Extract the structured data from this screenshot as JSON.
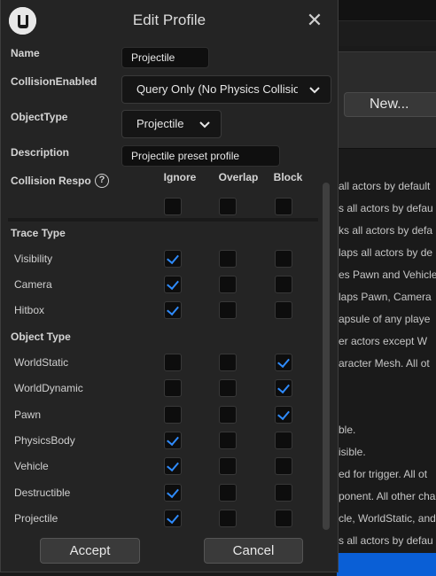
{
  "background": {
    "new_button": "New...",
    "description_lines": [
      "all actors by default",
      "s all actors by defau",
      "ks all actors by defa",
      "laps all actors by de",
      "es Pawn and Vehicle",
      "laps Pawn, Camera",
      "apsule of any playe",
      "er actors except W",
      "aracter Mesh. All ot",
      "ble.",
      "isible.",
      "ed for trigger. All ot",
      "ponent. All other cha",
      "cle, WorldStatic, and",
      "s all actors by defau"
    ],
    "accent_color": "#0a5fd6"
  },
  "dialog": {
    "title": "Edit Profile",
    "logo_icon": "unreal-logo-icon",
    "close_icon": "close-icon",
    "close_glyph": "✕",
    "fields": {
      "name_label": "Name",
      "name_value": "Projectile",
      "collision_label": "CollisionEnabled",
      "collision_value": "Query Only (No Physics Collision)",
      "object_type_label": "ObjectType",
      "object_type_value": "Projectile",
      "description_label": "Description",
      "description_value": "Projectile preset profile"
    },
    "responses_header": {
      "label": "Collision Respo",
      "help_glyph": "?",
      "columns": [
        "Ignore",
        "Overlap",
        "Block"
      ]
    },
    "all_row": [
      false,
      false,
      false
    ],
    "trace_type_label": "Trace Type",
    "trace_rows": [
      {
        "label": "Visibility",
        "checks": [
          true,
          false,
          false
        ]
      },
      {
        "label": "Camera",
        "checks": [
          true,
          false,
          false
        ]
      },
      {
        "label": "Hitbox",
        "checks": [
          true,
          false,
          false
        ]
      }
    ],
    "object_type_label": "Object Type",
    "object_rows": [
      {
        "label": "WorldStatic",
        "checks": [
          false,
          false,
          true
        ]
      },
      {
        "label": "WorldDynamic",
        "checks": [
          false,
          false,
          true
        ]
      },
      {
        "label": "Pawn",
        "checks": [
          false,
          false,
          true
        ]
      },
      {
        "label": "PhysicsBody",
        "checks": [
          true,
          false,
          false
        ]
      },
      {
        "label": "Vehicle",
        "checks": [
          true,
          false,
          false
        ]
      },
      {
        "label": "Destructible",
        "checks": [
          true,
          false,
          false
        ]
      },
      {
        "label": "Projectile",
        "checks": [
          true,
          false,
          false
        ]
      }
    ],
    "accept_label": "Accept",
    "cancel_label": "Cancel",
    "check_color": "#2f8cff"
  }
}
